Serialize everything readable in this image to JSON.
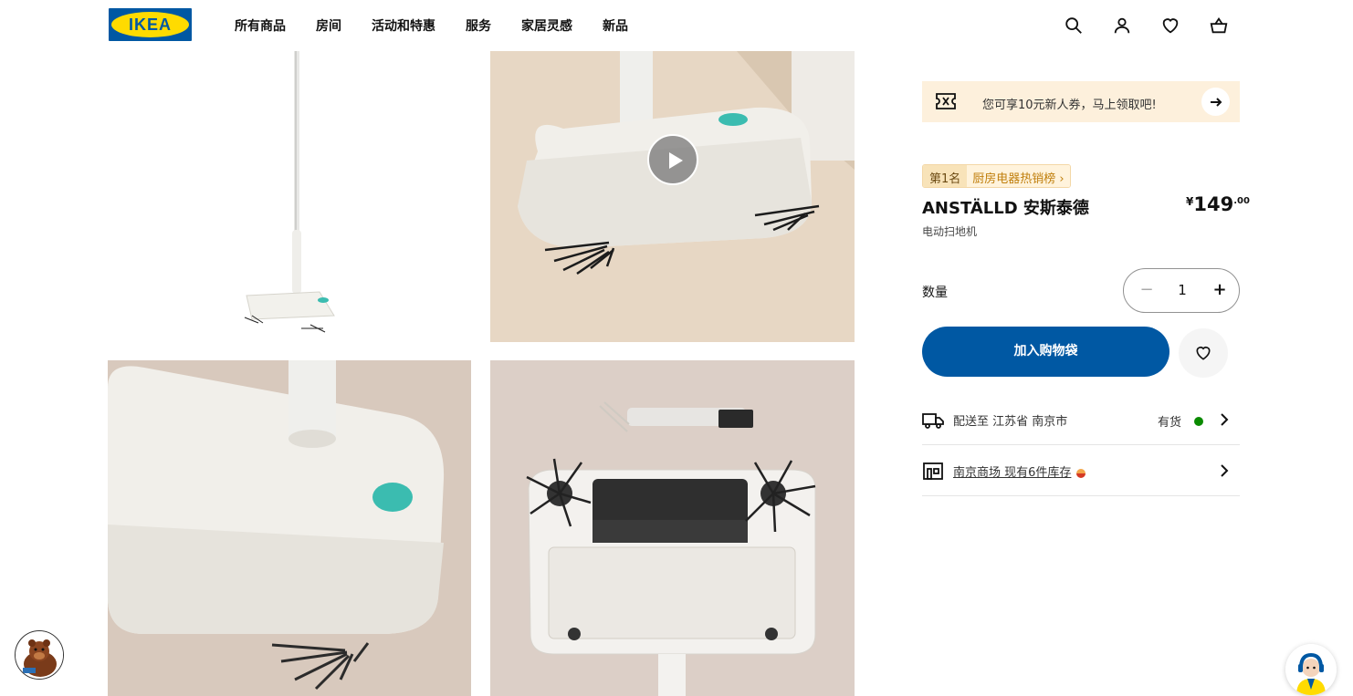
{
  "header": {
    "logo_text": "IKEA",
    "nav": [
      "所有商品",
      "房间",
      "活动和特惠",
      "服务",
      "家居灵感",
      "新品"
    ],
    "icons": [
      "search-icon",
      "user-icon",
      "heart-icon",
      "basket-icon"
    ]
  },
  "gallery": {
    "images": [
      "sweeper-full-product",
      "sweeper-video-thumbnail",
      "sweeper-closeup-base",
      "sweeper-underside-brush"
    ]
  },
  "promo": {
    "text": "您可享10元新人券，马上领取吧!"
  },
  "rank": {
    "number": "第1名",
    "category": "厨房电器热销榜 ›"
  },
  "product": {
    "name": "ANSTÄLLD 安斯泰德",
    "price_currency": "¥",
    "price_integer": "149",
    "price_decimal": ".00",
    "description": "电动扫地机"
  },
  "quantity": {
    "label": "数量",
    "value": "1",
    "minus": "−",
    "plus": "+"
  },
  "actions": {
    "add_to_bag": "加入购物袋"
  },
  "delivery": {
    "text": "配送至 江苏省 南京市",
    "status": "有货"
  },
  "store": {
    "text": "南京商场 现有6件库存"
  },
  "colors": {
    "brand_blue": "#0058a3",
    "brand_yellow": "#ffdb00",
    "in_stock": "#0a8a00"
  }
}
